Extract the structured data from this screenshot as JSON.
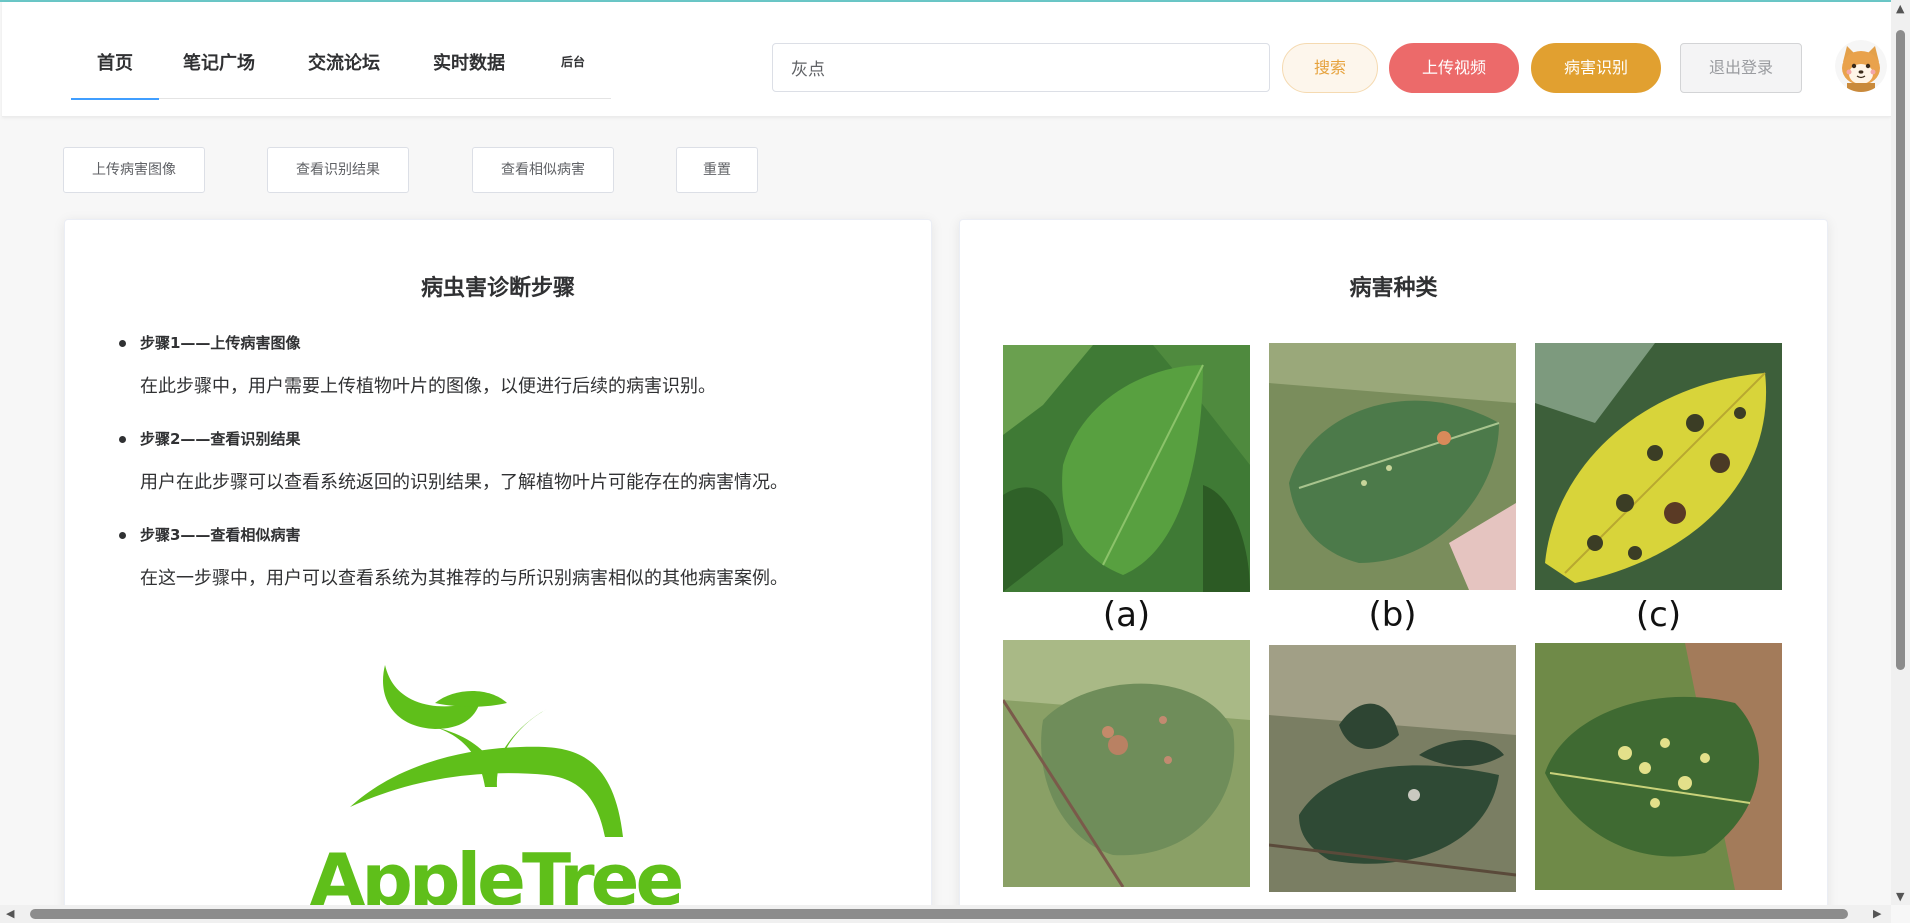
{
  "header": {
    "nav": [
      {
        "label": "首页",
        "active": true
      },
      {
        "label": "笔记广场",
        "active": false
      },
      {
        "label": "交流论坛",
        "active": false
      },
      {
        "label": "实时数据",
        "active": false
      },
      {
        "label": "后台",
        "active": false
      }
    ],
    "search_value": "灰点",
    "search_button": "搜索",
    "upload_video": "上传视频",
    "disease_identify": "病害识别",
    "logout": "退出登录",
    "avatar_icon": "shiba-dog-avatar"
  },
  "toolbar": {
    "buttons": [
      "上传病害图像",
      "查看识别结果",
      "查看相似病害",
      "重置"
    ]
  },
  "left_card": {
    "title": "病虫害诊断步骤",
    "steps": [
      {
        "head": "步骤1——上传病害图像",
        "desc": "在此步骤中，用户需要上传植物叶片的图像，以便进行后续的病害识别。"
      },
      {
        "head": "步骤2——查看识别结果",
        "desc": "用户在此步骤可以查看系统返回的识别结果，了解植物叶片可能存在的病害情况。"
      },
      {
        "head": "步骤3——查看相似病害",
        "desc": "在这一步骤中，用户可以查看系统为其推荐的与所识别病害相似的其他病害案例。"
      }
    ],
    "logo_text": "AppleTree"
  },
  "right_card": {
    "title": "病害种类",
    "captions": [
      "(a)",
      "(b)",
      "(c)"
    ]
  },
  "colors": {
    "accent_blue": "#409eff",
    "upload_red": "#ec6a6a",
    "identify_orange": "#e1a030",
    "logo_green": "#5fbf1a"
  }
}
